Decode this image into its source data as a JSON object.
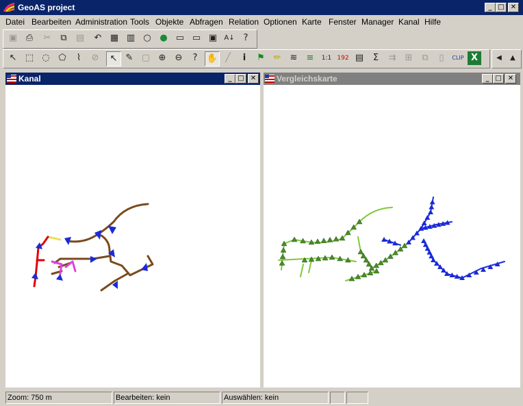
{
  "app": {
    "title": "GeoAS project"
  },
  "menu": [
    "Datei",
    "Bearbeiten",
    "Administration",
    "Tools",
    "Objekte",
    "Abfragen",
    "Relation",
    "Optionen",
    "Karte",
    "Fenster",
    "Manager",
    "Kanal",
    "Hilfe"
  ],
  "windows": {
    "left": {
      "title": "Kanal"
    },
    "right": {
      "title": "Vergleichskarte"
    }
  },
  "status": {
    "zoom": "Zoom: 750 m",
    "edit": "Bearbeiten: kein",
    "select": "Auswählen: kein"
  },
  "toolbar1_icons": [
    "save-icon",
    "print-icon",
    "cut-icon",
    "copy-icon",
    "paste-icon",
    "undo-icon",
    "table-icon",
    "form-icon",
    "search-icon",
    "globe-icon",
    "window-icon",
    "window2-icon",
    "window3-icon",
    "sort-icon",
    "help-pointer-icon"
  ],
  "toolbar2_icons": [
    "pointer-icon",
    "select-rect-icon",
    "select-circle-icon",
    "select-poly-icon",
    "select-line-icon",
    "cancel-select-icon",
    "arrow-select-icon",
    "pencil-icon",
    "frame-icon",
    "zoom-in-icon",
    "zoom-out-icon",
    "zoom-query-icon",
    "pan-hand-icon",
    "draw-line-icon",
    "info-icon",
    "flag-icon",
    "ruler-icon",
    "wave-icon",
    "layers-icon",
    "scale-icon",
    "number-icon",
    "list-icon",
    "sum-icon",
    "route-icon",
    "network-icon",
    "link-icon",
    "doc-icon",
    "clip-icon",
    "excel-icon",
    "prev-icon",
    "up-icon"
  ]
}
